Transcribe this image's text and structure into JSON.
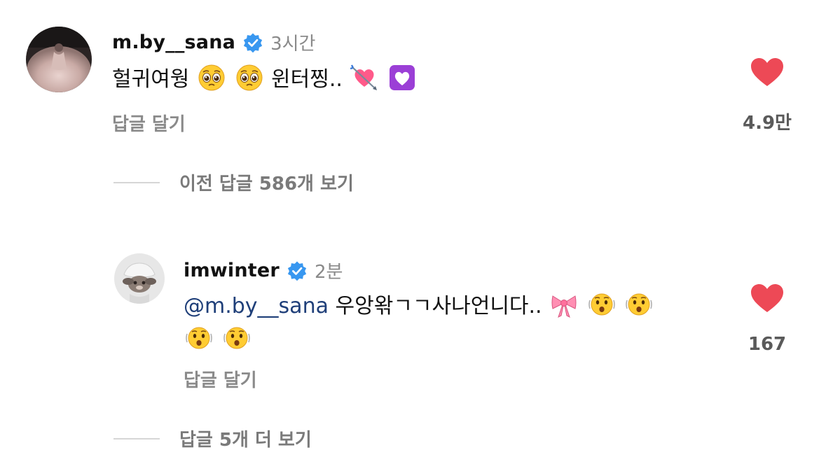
{
  "comments": [
    {
      "username": "m.by__sana",
      "time": "3시간",
      "text_before": "헐귀여웡",
      "text_mid": "윈터찡..",
      "emojis_a": [
        "pleading-face-emoji",
        "pleading-face-emoji"
      ],
      "emojis_b": [
        "heart-with-arrow-emoji",
        "white-heart-purple-square-emoji"
      ],
      "reply_label": "답글 달기",
      "likes": "4.9만"
    },
    {
      "username": "imwinter",
      "time": "2분",
      "mention": "@m.by__sana",
      "text": "우앙왂ㄱㄱ사나언니다..",
      "emojis_line1": [
        "ribbon-emoji",
        "astonished-shaking-face-emoji",
        "astonished-shaking-face-emoji"
      ],
      "emojis_line2": [
        "astonished-shaking-face-emoji",
        "astonished-shaking-face-emoji"
      ],
      "reply_label": "답글 달기",
      "likes": "167"
    }
  ],
  "threads": {
    "view_previous": "이전 답글 586개 보기",
    "view_more": "답글 5개 더 보기"
  },
  "colors": {
    "like_red": "#ed4956",
    "verified_blue": "#3897f0",
    "mention": "#1f3f79",
    "secondary_text": "#8a8a8a"
  },
  "icons": [
    "verified-badge-icon",
    "heart-icon"
  ]
}
